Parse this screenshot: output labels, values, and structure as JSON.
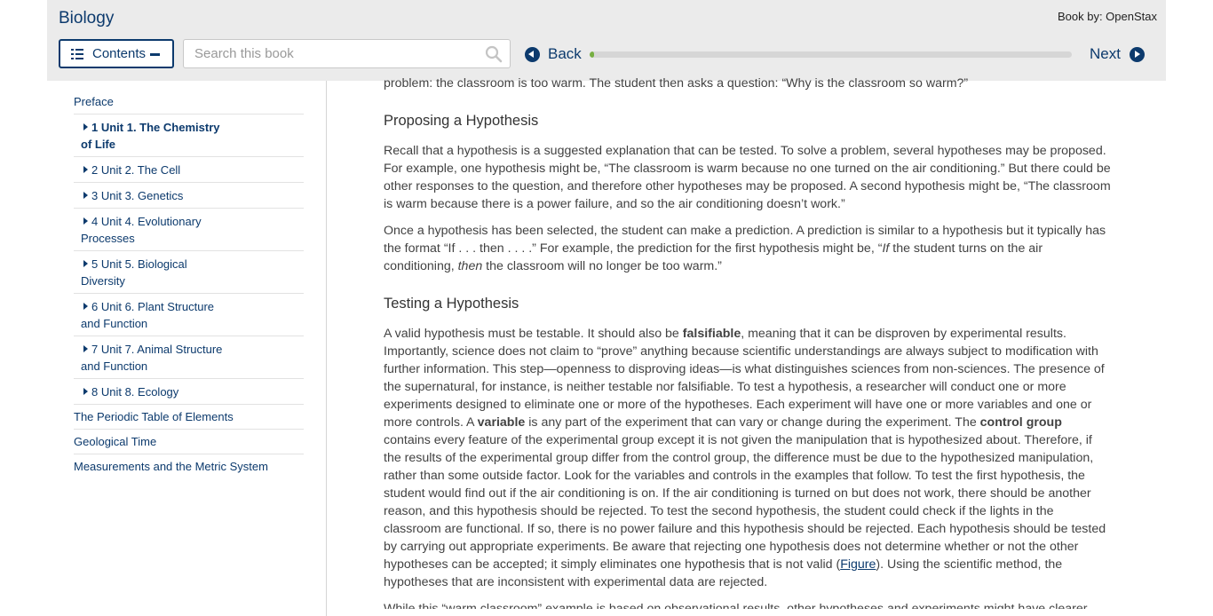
{
  "header": {
    "book_title": "Biology",
    "book_by": "Book by: OpenStax",
    "contents_label": "Contents",
    "search_placeholder": "Search this book",
    "back_label": "Back",
    "next_label": "Next",
    "progress_fraction": 0.01,
    "accent_color": "#0c3a6d",
    "progress_color": "#77af42"
  },
  "toc": {
    "preface": "Preface",
    "units": [
      "1 Unit 1. The Chemistry of Life",
      "2 Unit 2. The Cell",
      "3 Unit 3. Genetics",
      "4 Unit 4. Evolutionary Processes",
      "5 Unit 5. Biological Diversity",
      "6 Unit 6. Plant Structure and Function",
      "7 Unit 7. Animal Structure and Function",
      "8 Unit 8. Ecology"
    ],
    "appendices": [
      "The Periodic Table of Elements",
      "Geological Time",
      "Measurements and the Metric System"
    ]
  },
  "content": {
    "top_cut_text": "problem: the classroom is too warm. The student then asks a question: “Why is the classroom so warm?”",
    "section1_title": "Proposing a Hypothesis",
    "section1_p1": "Recall that a hypothesis is a suggested explanation that can be tested. To solve a problem, several hypotheses may be proposed. For example, one hypothesis might be, “The classroom is warm because no one turned on the air conditioning.” But there could be other responses to the question, and therefore other hypotheses may be proposed. A second hypothesis might be, “The classroom is warm because there is a power failure, and so the air conditioning doesn’t work.”",
    "section1_p2_a": "Once a hypothesis has been selected, the student can make a prediction. A prediction is similar to a hypothesis but it typically has the format “If . . . then . . . .” For example, the prediction for the first hypothesis might be, “",
    "section1_p2_if": "If",
    "section1_p2_b": " the student turns on the air conditioning, ",
    "section1_p2_then": "then",
    "section1_p2_c": " the classroom will no longer be too warm.”",
    "section2_title": "Testing a Hypothesis",
    "section2_a": "A valid hypothesis must be testable. It should also be ",
    "section2_falsifiable": "falsifiable",
    "section2_b": ", meaning that it can be disproven by experimental results. Importantly, science does not claim to “prove” anything because scientific understandings are always subject to modification with further information. This step—openness to disproving ideas—is what distinguishes sciences from non-sciences. The presence of the supernatural, for instance, is neither testable nor falsifiable. To test a hypothesis, a researcher will conduct one or more experiments designed to eliminate one or more of the hypotheses. Each experiment will have one or more variables and one or more controls. A ",
    "section2_variable": "variable",
    "section2_c": " is any part of the experiment that can vary or change during the experiment. The ",
    "section2_control_group": "control group",
    "section2_d": " contains every feature of the experimental group except it is not given the manipulation that is hypothesized about. Therefore, if the results of the experimental group differ from the control group, the difference must be due to the hypothesized manipulation, rather than some outside factor. Look for the variables and controls in the examples that follow. To test the first hypothesis, the student would find out if the air conditioning is on. If the air conditioning is turned on but does not work, there should be another reason, and this hypothesis should be rejected. To test the second hypothesis, the student could check if the lights in the classroom are functional. If so, there is no power failure and this hypothesis should be rejected. Each hypothesis should be tested by carrying out appropriate experiments. Be aware that rejecting one hypothesis does not determine whether or not the other hypotheses can be accepted; it simply eliminates one hypothesis that is not valid (",
    "section2_figure_link": "Figure",
    "section2_e": "). Using the scientific method, the hypotheses that are inconsistent with experimental data are rejected.",
    "bottom_cut_text": "While this “warm classroom” example is based on observational results, other hypotheses and experiments might have clearer controls."
  }
}
